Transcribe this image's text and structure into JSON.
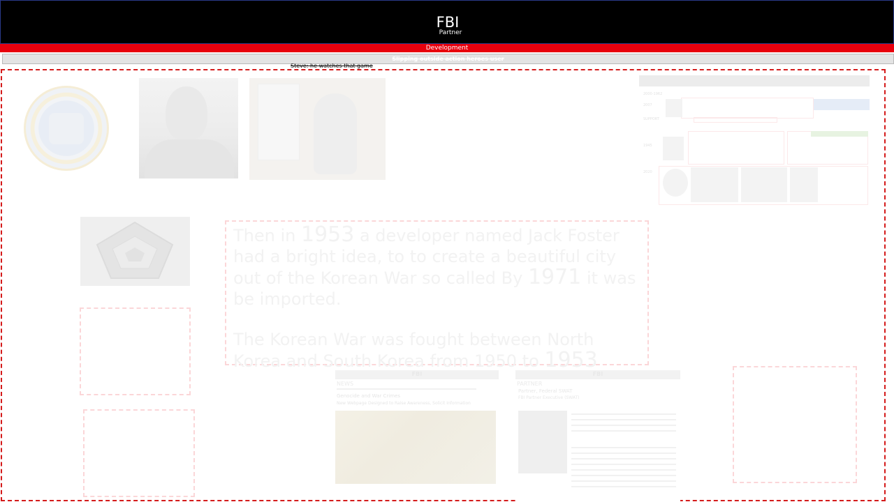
{
  "header": {
    "title": "FBI",
    "subtitle": "Partner"
  },
  "dev_bar": {
    "label": "Development"
  },
  "strip": {
    "text": "Slipping outside action heroes user"
  },
  "caption": {
    "text": "Steve: he watches that game"
  },
  "text_block": {
    "para1_a": "Then in ",
    "para1_year": "1953",
    "para1_b": " a developer named Jack Foster had a bright idea, to to create a beautiful city out of the Korean War so called ",
    "para1_c": "By ",
    "para1_year2": "1971",
    "para1_d": " it was be imported.",
    "para2_a": "The Korean War was fought between North Korea and South Korea from 1950 to ",
    "para2_year": "1953"
  },
  "news_cards": [
    {
      "masthead": "FBI",
      "section": "NEWS",
      "kicker": "Genocide and War Crimes",
      "headline": "New Webpage Designed to Raise Awareness, Solicit Information"
    },
    {
      "masthead": "FBI",
      "section": "PARTNER",
      "kicker": "Partner, Federal SWAT",
      "headline": "FBI Partner Executive (SWAT)"
    }
  ],
  "minimap": {
    "rows": [
      "2000-1962",
      "2007",
      "SUPPORT",
      "1945",
      "2020"
    ]
  },
  "colors": {
    "header_bg": "#000000",
    "dev_bar": "#e8000d",
    "frame_dash": "#d41a1a"
  }
}
